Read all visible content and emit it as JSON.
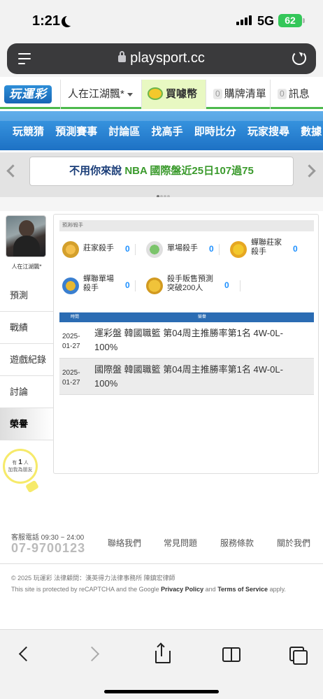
{
  "status": {
    "time": "1:21",
    "network": "5G",
    "battery": "62"
  },
  "browser": {
    "url": "playsport.cc"
  },
  "header": {
    "logo": "玩運彩",
    "user": "人在江湖飄*",
    "buy_coin": "買噱幣",
    "purchase_count": "0",
    "purchase_list": "購牌清單",
    "message_count": "0",
    "messages": "訊息"
  },
  "nav": {
    "items": [
      "玩競猜",
      "預測賽事",
      "討論區",
      "找高手",
      "即時比分",
      "玩家搜尋",
      "數據"
    ]
  },
  "carousel": {
    "prefix": "不用你來說 ",
    "highlight": "NBA 國際盤近25日107過75"
  },
  "sidebar": {
    "username": "人在江湖飄*",
    "items": [
      "預測",
      "戰績",
      "遊戲紀錄",
      "討論",
      "榮譽"
    ],
    "active": "榮譽",
    "tip_prefix": "有",
    "tip_count": "1",
    "tip_suffix": "人",
    "tip_text": "加我為朋友"
  },
  "main": {
    "breadcrumb": "預測/殺手",
    "honors": [
      {
        "label": "莊家殺手",
        "count": "0",
        "icon": "bank-killer-badge-icon"
      },
      {
        "label": "單場殺手",
        "count": "0",
        "icon": "single-killer-badge-icon"
      },
      {
        "label": "蟬聯莊家殺手",
        "count": "0",
        "icon": "consecutive-bank-killer-badge-icon"
      },
      {
        "label": "蟬聯單場殺手",
        "count": "0",
        "icon": "consecutive-single-killer-badge-icon"
      },
      {
        "label": "殺手販售預測突破200人",
        "count": "0",
        "icon": "sales-badge-icon"
      }
    ],
    "table": {
      "headers": [
        "時間",
        "榮譽"
      ],
      "rows": [
        {
          "date": "2025-01-27",
          "text": "運彩盤 韓國職籃 第04周主推勝率第1名 4W-0L-100%"
        },
        {
          "date": "2025-01-27",
          "text": "國際盤 韓國職籃 第04周主推勝率第1名 4W-0L-100%"
        }
      ]
    }
  },
  "footer": {
    "service_hours": "客服電話 09:30 ~ 24:00",
    "phone": "07-9700123",
    "links": [
      "聯絡我們",
      "常見問題",
      "服務條款",
      "關於我們"
    ],
    "copyright": "© 2025 玩運彩 法律顧問：漢英得力法律事務所 陳鎮宏律師",
    "captcha_prefix": "This site is protected by reCAPTCHA and the Google ",
    "privacy": "Privacy Policy",
    "and": " and ",
    "terms": "Terms of Service",
    "apply": " apply."
  },
  "colors": {
    "nav_blue": "#1d71c4",
    "brand_green": "#4cb94c",
    "count_blue": "#1e90ff",
    "table_head": "#2b6cb3"
  }
}
